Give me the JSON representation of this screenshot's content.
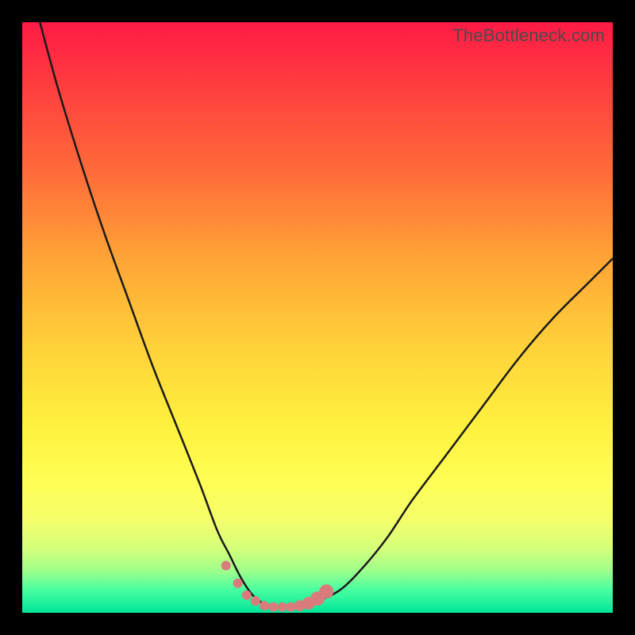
{
  "watermark": "TheBottleneck.com",
  "colors": {
    "frame": "#000000",
    "curve_stroke": "#1a1a1a",
    "marker_fill": "#d97b7b",
    "gradient_top": "#ff1a46",
    "gradient_bottom": "#00e59a"
  },
  "chart_data": {
    "type": "line",
    "title": "",
    "xlabel": "",
    "ylabel": "",
    "xlim": [
      0,
      100
    ],
    "ylim": [
      0,
      100
    ],
    "grid": false,
    "legend": false,
    "series": [
      {
        "name": "bottleneck-curve",
        "x": [
          3,
          6,
          10,
          14,
          18,
          22,
          26,
          30,
          33,
          35,
          37,
          39,
          41,
          43,
          45,
          47,
          50,
          54,
          58,
          62,
          66,
          72,
          78,
          84,
          90,
          96,
          100
        ],
        "y": [
          100,
          89,
          76,
          64,
          53,
          42,
          32,
          22,
          14,
          10,
          6,
          3,
          1.5,
          1,
          1,
          1.2,
          2,
          4,
          8,
          13,
          19,
          27,
          35,
          43,
          50,
          56,
          60
        ]
      }
    ],
    "markers": {
      "name": "trough-dots",
      "x": [
        34.5,
        36.5,
        38,
        39.5,
        41,
        42.5,
        44,
        45.5,
        47,
        48.5,
        50,
        51.5
      ],
      "y": [
        8,
        5,
        3,
        2,
        1.2,
        1,
        1,
        1,
        1.2,
        1.6,
        2.4,
        3.6
      ],
      "r": [
        6,
        6,
        6,
        6,
        6,
        6,
        6,
        6,
        7,
        8,
        9,
        9
      ]
    }
  }
}
